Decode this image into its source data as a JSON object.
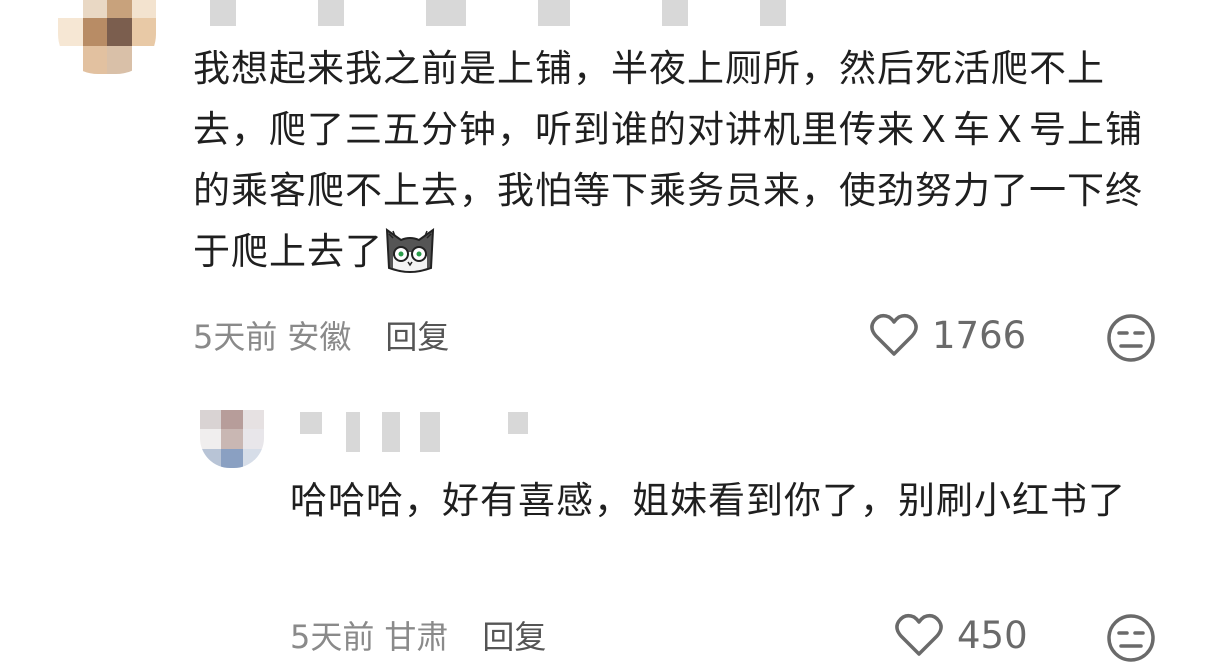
{
  "comments": [
    {
      "text_main": "我想起来我之前是上铺，半夜上厕所，然后死活爬不上去，爬了三五分钟，听到谁的对讲机里传来Ｘ车Ｘ号上铺的乘客爬不上去，我怕等下乘务员来，使劲努力了一下终于爬上去了",
      "time": "5天前",
      "location": "安徽",
      "reply_label": "回复",
      "likes": "1766",
      "emoji_icon": "shocked-cat-sticker-icon",
      "avatar_colors": [
        "#ffffff",
        "#e9d8c4",
        "#c8a27c",
        "#f3e3cf",
        "#f6e7d4",
        "#b88c65",
        "#7b5e4e",
        "#e8c9a6",
        "#ffffff",
        "#e2c1a0",
        "#d9c0a8",
        "#ffffff"
      ]
    },
    {
      "text_main": "哈哈哈，好有喜感，姐妹看到你了，别刷小红书了",
      "time": "5天前",
      "location": "甘肃",
      "reply_label": "回复",
      "likes": "450",
      "avatar_colors": [
        "#d9d3d3",
        "#b79d9a",
        "#e6e1e2",
        "#f0eeee",
        "#c9b7b3",
        "#e8e6ea",
        "#b8c4d6",
        "#8aa0c2",
        "#d6dde8"
      ]
    }
  ],
  "icons": {
    "like": "heart-outline-icon",
    "dislike": "neutral-face-icon"
  },
  "colors": {
    "text": "#1f1f1f",
    "meta": "#8a8a8a",
    "reply": "#555555",
    "icon": "#6a6a6a"
  }
}
